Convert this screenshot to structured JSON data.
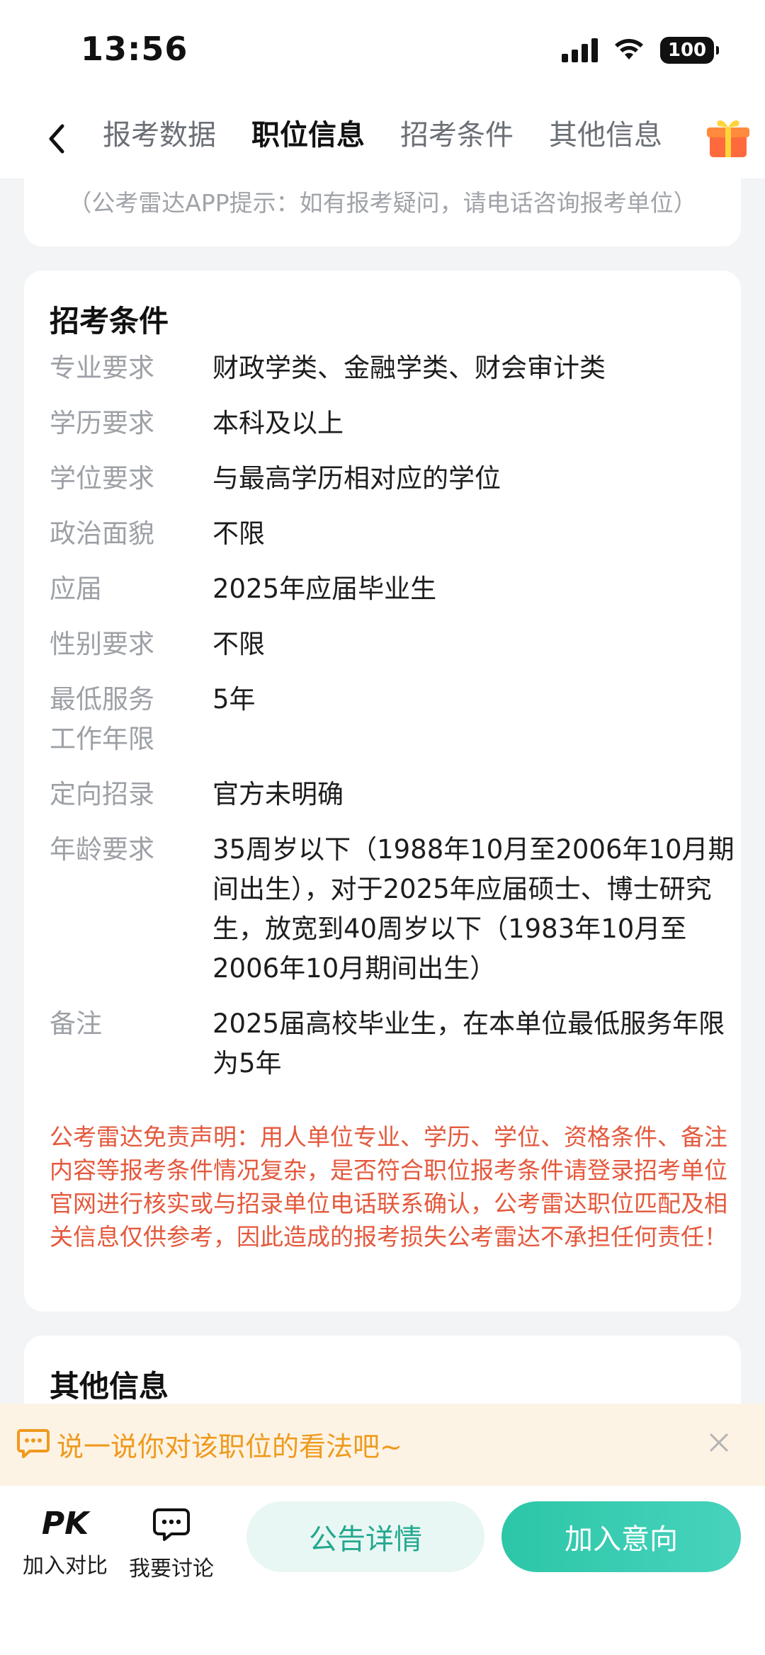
{
  "status_bar": {
    "time": "13:56",
    "battery": "100"
  },
  "nav": {
    "tabs": [
      {
        "label": "报考数据"
      },
      {
        "label": "职位信息"
      },
      {
        "label": "招考条件"
      },
      {
        "label": "其他信息"
      }
    ],
    "active_tab": "职位信息"
  },
  "hint": "（公考雷达APP提示：如有报考疑问，请电话咨询报考单位）",
  "conditions": {
    "title": "招考条件",
    "rows": [
      {
        "label": "专业要求",
        "value": "财政学类、金融学类、财会审计类"
      },
      {
        "label": "学历要求",
        "value": "本科及以上"
      },
      {
        "label": "学位要求",
        "value": "与最高学历相对应的学位"
      },
      {
        "label": "政治面貌",
        "value": "不限"
      },
      {
        "label": "应届",
        "value": "2025年应届毕业生"
      },
      {
        "label": "性别要求",
        "value": "不限"
      },
      {
        "label": "最低服务工作年限",
        "value": "5年"
      },
      {
        "label": "定向招录",
        "value": "官方未明确"
      },
      {
        "label": "年龄要求",
        "value": "35周岁以下（1988年10月至2006年10月期间出生），对于2025年应届硕士、博士研究生，放宽到40周岁以下（1983年10月至2006年10月期间出生）"
      },
      {
        "label": "备注",
        "value": "2025届高校毕业生，在本单位最低服务年限为5年"
      }
    ],
    "disclaimer": "公考雷达免责声明：用人单位专业、学历、学位、资格条件、备注内容等报考条件情况复杂，是否符合职位报考条件请登录招考单位官网进行核实或与招录单位电话联系确认，公考雷达职位匹配及相关信息仅供参考，因此造成的报考损失公考雷达不承担任何责任！"
  },
  "other": {
    "title": "其他信息"
  },
  "banner": {
    "text": "说一说你对该职位的看法吧~"
  },
  "bottom_bar": {
    "pk_icon_text": "PK",
    "compare_label": "加入对比",
    "discuss_label": "我要讨论",
    "notice_button": "公告详情",
    "join_button": "加入意向"
  },
  "colors": {
    "accent": "#2bbfa4",
    "warning": "#e4593d",
    "banner_text": "#ef9a1e"
  }
}
